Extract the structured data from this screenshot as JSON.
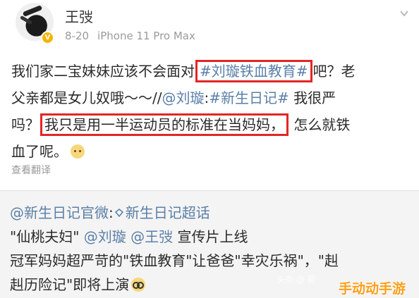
{
  "post": {
    "author": "王弢",
    "meta": {
      "date": "8-20",
      "device": "iPhone 11 Pro Max"
    },
    "verified_badge": "V",
    "text_lines": [
      [
        "我们家二宝妹妹应该不会面对",
        "#刘璇铁血教育#",
        "吧？老"
      ],
      [
        "父亲都是女儿奴哦～～//",
        "@刘璇",
        ":",
        "#新生日记#",
        " 我很严"
      ],
      [
        "吗？",
        "我只是用一半运动员的标准在当妈妈，",
        " 怎么就铁"
      ],
      [
        "血了呢。"
      ]
    ],
    "see_translation": "查看翻译"
  },
  "repost": {
    "line1": {
      "account": "@新生日记官微",
      "colon": ":",
      "supertopic": "新生日记超话"
    },
    "line2": {
      "open": "\"仙桃夫妇\" ",
      "mention1": "@刘璇",
      "space": " ",
      "mention2": "@王弢",
      "rest": " 宣传片上线"
    },
    "line3": "冠军妈妈超严苛的\"铁血教育\"让爸爸\"幸灾乐祸\"，\"赳",
    "line4": "赳历险记\"即将上演"
  },
  "watermarks": {
    "faint": "头条 @ 荷",
    "brand": "手动动手游"
  },
  "colors": {
    "link": "#5a7fa8",
    "highlight_box": "#e22626",
    "repost_bg": "#f4f4f4",
    "brand_orange": "#ff9f1a"
  },
  "icons": [
    "avatar",
    "verified-badge-icon",
    "chevron-down-icon",
    "sleepy-emoji-icon",
    "diamond-supertopic-icon",
    "glasses-emoji-icon"
  ]
}
